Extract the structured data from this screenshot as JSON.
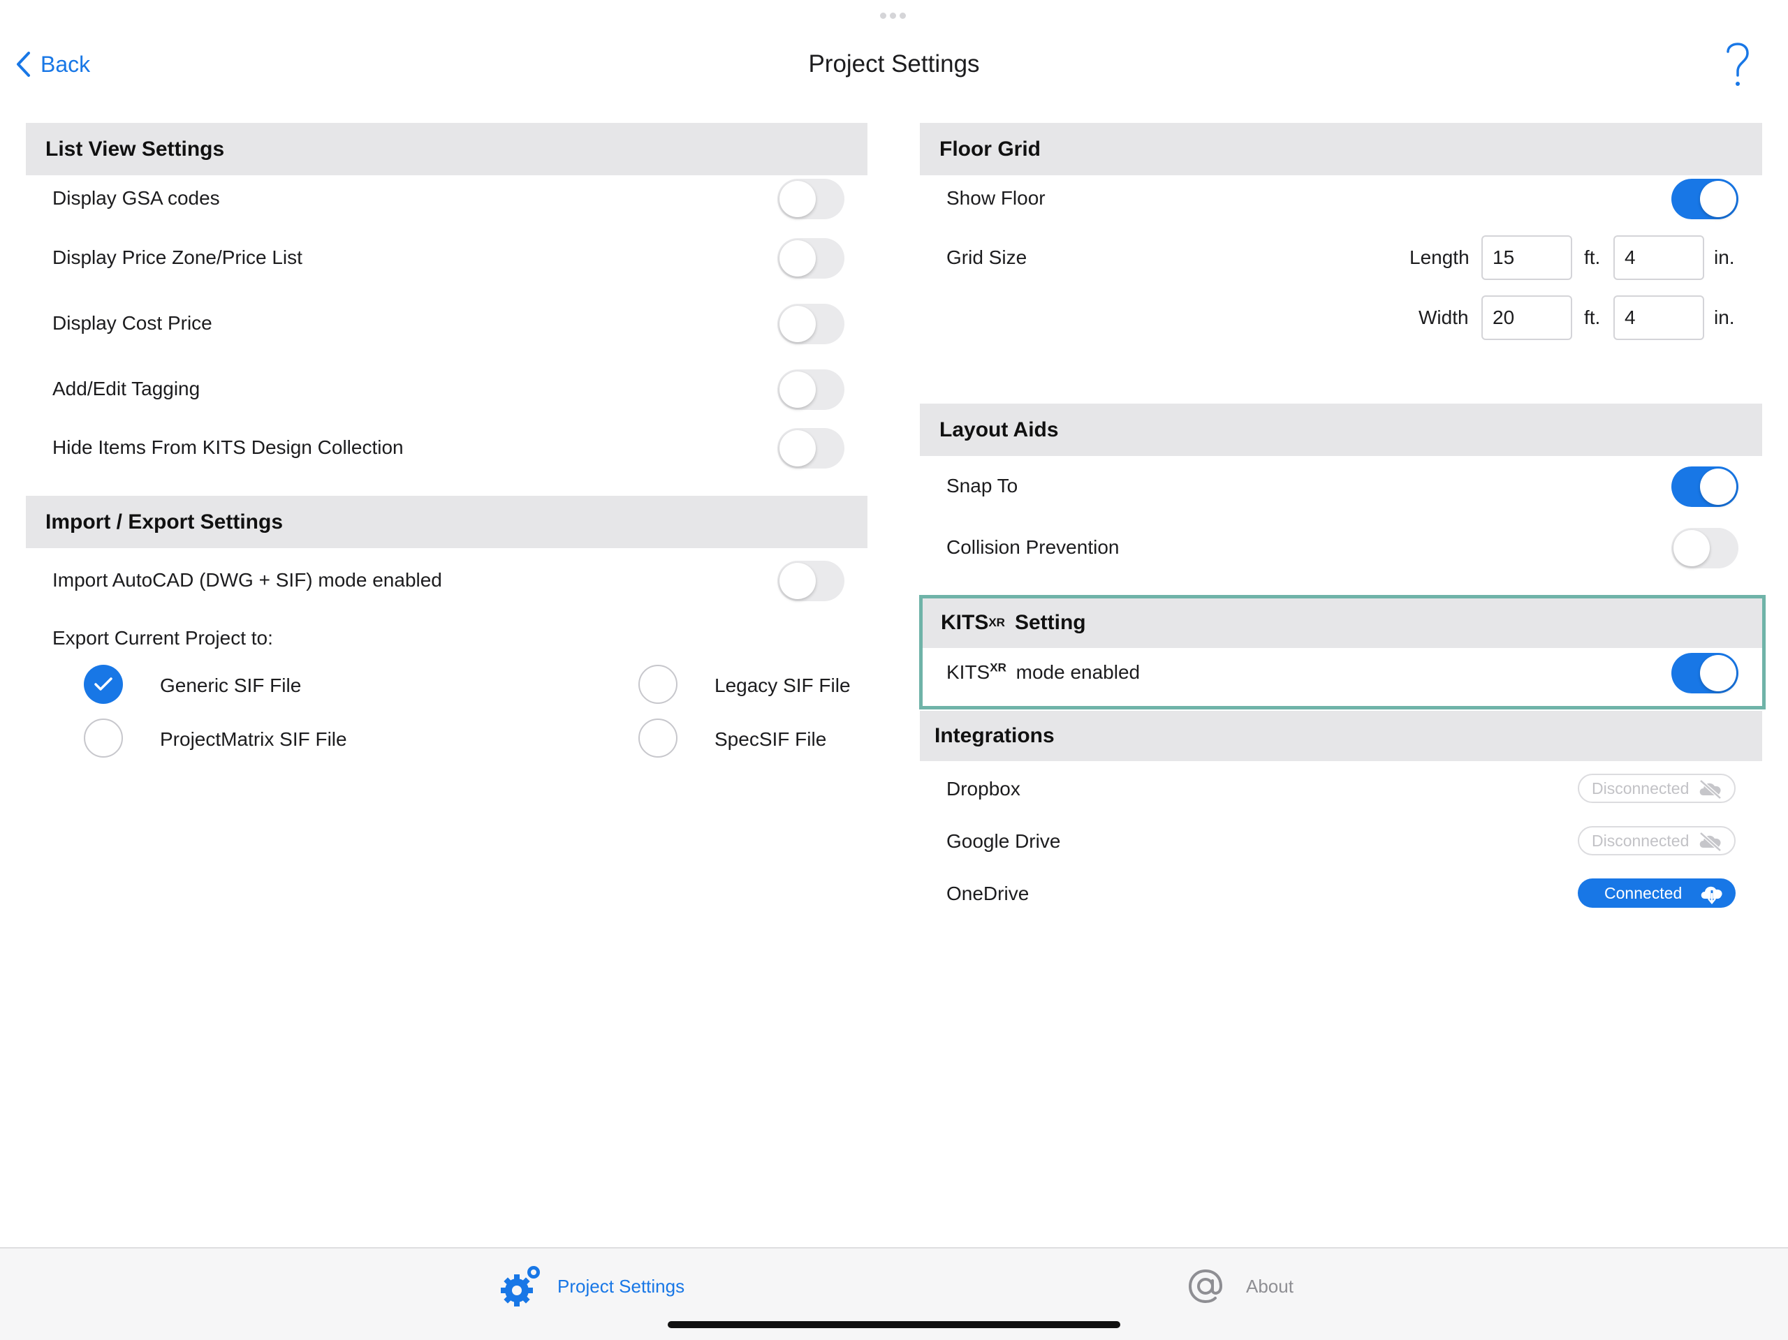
{
  "nav": {
    "back_label": "Back",
    "title": "Project Settings",
    "help_icon": "question-mark-icon"
  },
  "list_view_settings": {
    "header": "List View Settings",
    "rows": [
      {
        "label": "Display GSA codes",
        "enabled": false
      },
      {
        "label": "Display Price Zone/Price List",
        "enabled": false
      },
      {
        "label": "Display Cost Price",
        "enabled": false
      },
      {
        "label": "Add/Edit Tagging",
        "enabled": false
      },
      {
        "label": "Hide Items From KITS Design Collection",
        "enabled": false
      }
    ]
  },
  "import_export": {
    "header": "Import / Export Settings",
    "autocad_label": "Import AutoCAD (DWG + SIF) mode enabled",
    "autocad_enabled": false,
    "export_label": "Export Current Project to:",
    "options": [
      {
        "label": "Generic SIF File",
        "selected": true
      },
      {
        "label": "Legacy SIF File",
        "selected": false
      },
      {
        "label": "ProjectMatrix SIF File",
        "selected": false
      },
      {
        "label": "SpecSIF File",
        "selected": false
      }
    ]
  },
  "floor_grid": {
    "header": "Floor Grid",
    "show_floor_label": "Show Floor",
    "show_floor_enabled": true,
    "grid_size_label": "Grid Size",
    "length_label": "Length",
    "length_ft": "15",
    "length_in": "4",
    "width_label": "Width",
    "width_ft": "20",
    "width_in": "4",
    "ft_unit": "ft.",
    "in_unit": "in."
  },
  "layout_aids": {
    "header": "Layout Aids",
    "snap_label": "Snap To",
    "snap_enabled": true,
    "collision_label": "Collision Prevention",
    "collision_enabled": false
  },
  "kits_xr": {
    "brand": "KITS",
    "superscript": "XR",
    "header_suffix": "Setting",
    "mode_suffix": "mode enabled",
    "mode_enabled": true
  },
  "integrations": {
    "header": "Integrations",
    "services": [
      {
        "label": "Dropbox",
        "status": "Disconnected",
        "connected": false
      },
      {
        "label": "Google Drive",
        "status": "Disconnected",
        "connected": false
      },
      {
        "label": "OneDrive",
        "status": "Connected",
        "connected": true
      }
    ]
  },
  "tabbar": {
    "tabs": [
      {
        "label": "Project Settings",
        "icon": "gear-icon",
        "active": true
      },
      {
        "label": "About",
        "icon": "at-sign-icon",
        "active": false
      }
    ]
  },
  "colors": {
    "accent": "#1877e6",
    "section_bg": "#e6e6e8",
    "highlight_border": "#6fb3a8",
    "inactive_tab": "#8e8e93"
  }
}
